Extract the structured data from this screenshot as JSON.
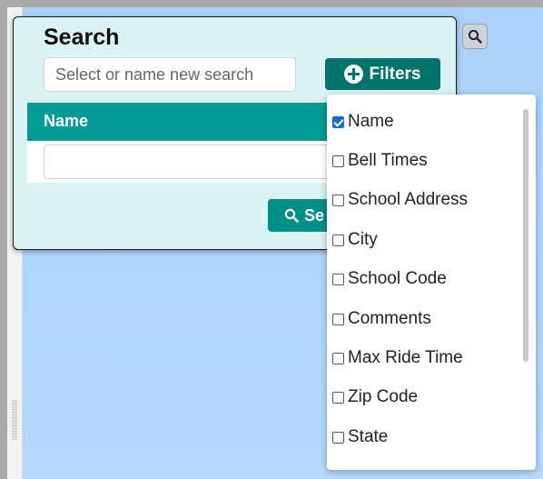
{
  "panel": {
    "title": "Search",
    "search_placeholder": "Select or name new search",
    "filters_label": "Filters",
    "name_header": "Name",
    "search_button_label": "Se"
  },
  "filters": [
    {
      "label": "Name",
      "checked": true
    },
    {
      "label": "Bell Times",
      "checked": false
    },
    {
      "label": "School Address",
      "checked": false
    },
    {
      "label": "City",
      "checked": false
    },
    {
      "label": "School Code",
      "checked": false
    },
    {
      "label": "Comments",
      "checked": false
    },
    {
      "label": "Max Ride Time",
      "checked": false
    },
    {
      "label": "Zip Code",
      "checked": false
    },
    {
      "label": "State",
      "checked": false
    }
  ],
  "colors": {
    "accent_dark": "#00736d",
    "accent": "#009b94",
    "panel_bg": "#d9f4f3",
    "checkbox_checked": "#0f6fd1"
  },
  "icons": {
    "filters": "plus-circle-icon",
    "search": "magnifier-icon"
  }
}
